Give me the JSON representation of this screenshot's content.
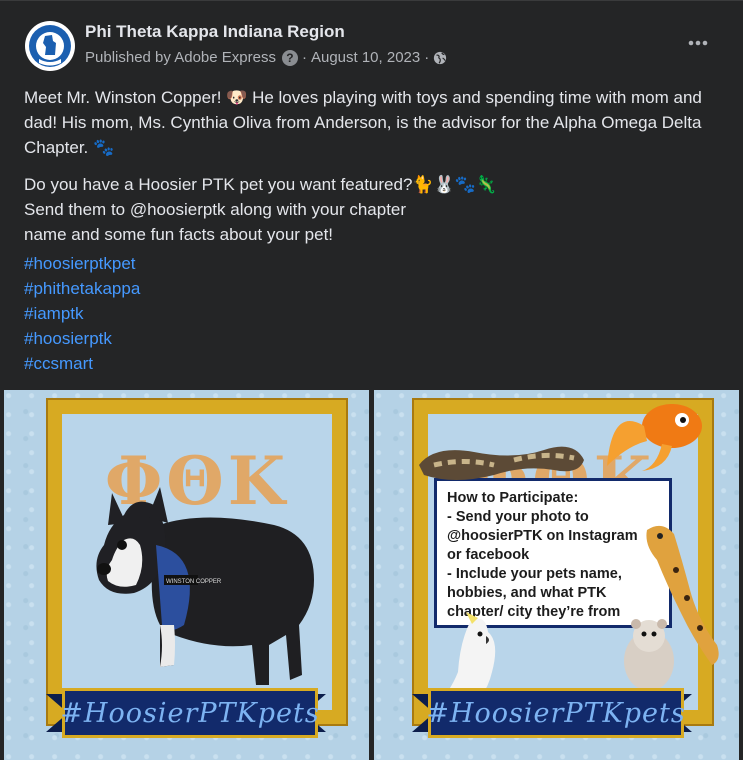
{
  "post": {
    "page_name": "Phi Theta Kappa Indiana Region",
    "published_by": "Published by Adobe Express",
    "separator": "·",
    "date": "August 10, 2023",
    "avatar_text": "INDIANA REGION",
    "paragraphs": [
      "Meet Mr. Winston Copper! 🐶 He loves playing with toys and spending time with mom and dad! His mom, Ms. Cynthia Oliva from Anderson, is the advisor for the Alpha Omega Delta Chapter. 🐾",
      "Do you have a Hoosier PTK pet you want featured?🐈🐰🐾🦎\nSend them to @hoosierptk along with your chapter\nname and some fun facts about your pet!"
    ],
    "hashtags": [
      "#hoosierptkpet",
      "#phithetakappa",
      "#iamptk",
      "#hoosierptk",
      "#ccsmart"
    ]
  },
  "photo1": {
    "greek_letters": "ΦΘΚ",
    "dog_vest_text": "WINSTON COPPER",
    "banner": "#HoosierPTKpets"
  },
  "photo2": {
    "greek_letters": "ΦΘΚ",
    "info_lines": [
      "How to Participate:",
      "- Send your photo to",
      "@hoosierPTK on Instagram",
      "or facebook",
      "- Include your pets name,",
      "hobbies, and what PTK",
      "chapter/ city they’re from"
    ],
    "banner": "#HoosierPTKpets"
  },
  "colors": {
    "background": "#242526",
    "text": "#e4e6eb",
    "secondary_text": "#b0b3b8",
    "link": "#4599ff",
    "gold": "#d7aa22",
    "navy": "#122a6b"
  },
  "icons": {
    "help": "question-icon",
    "privacy": "globe-icon",
    "more": "more-options-icon"
  }
}
